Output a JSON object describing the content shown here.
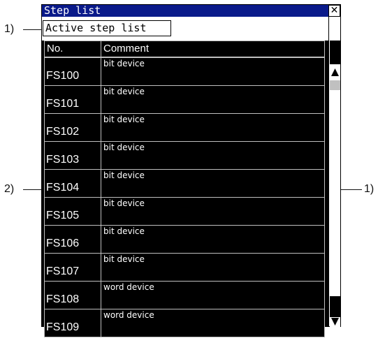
{
  "callouts": {
    "selector": "1)",
    "scrollbar": "1)",
    "table": "2)"
  },
  "window": {
    "title": "Step list",
    "close_symbol": "✕",
    "selector_value": "Active step list"
  },
  "table": {
    "columns": [
      "No.",
      "Comment"
    ],
    "rows": [
      {
        "no": "FS100",
        "comment": "bit device"
      },
      {
        "no": "FS101",
        "comment": "bit device"
      },
      {
        "no": "FS102",
        "comment": "bit device"
      },
      {
        "no": "FS103",
        "comment": "bit device"
      },
      {
        "no": "FS104",
        "comment": "bit device"
      },
      {
        "no": "FS105",
        "comment": "bit device"
      },
      {
        "no": "FS106",
        "comment": "bit device"
      },
      {
        "no": "FS107",
        "comment": "bit device"
      },
      {
        "no": "FS108",
        "comment": "word device"
      },
      {
        "no": "FS109",
        "comment": "word device"
      }
    ]
  },
  "scrollbar": {
    "icons": [
      "arrow-up-icon",
      "arrow-down-icon"
    ]
  }
}
